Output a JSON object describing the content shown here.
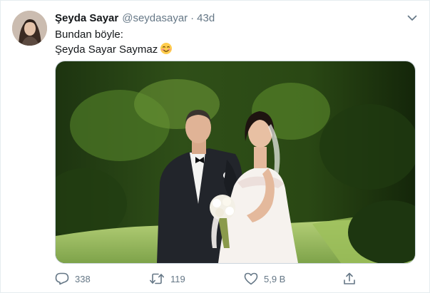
{
  "tweet": {
    "author_name": "Şeyda Sayar",
    "author_handle": "@seydasayar",
    "separator": "·",
    "time": "43d",
    "text_line1": "Bundan böyle:",
    "text_line2": "Şeyda Sayar Saymaz",
    "emoji_icon": "smiling-face-with-blush-emoji"
  },
  "actions": {
    "reply_count": "338",
    "retweet_count": "119",
    "like_count": "5,9 B",
    "icons": [
      "reply-icon",
      "retweet-icon",
      "like-icon",
      "share-icon"
    ]
  },
  "colors": {
    "text_primary": "#14171a",
    "text_secondary": "#657786",
    "border": "#e6ecf0"
  }
}
